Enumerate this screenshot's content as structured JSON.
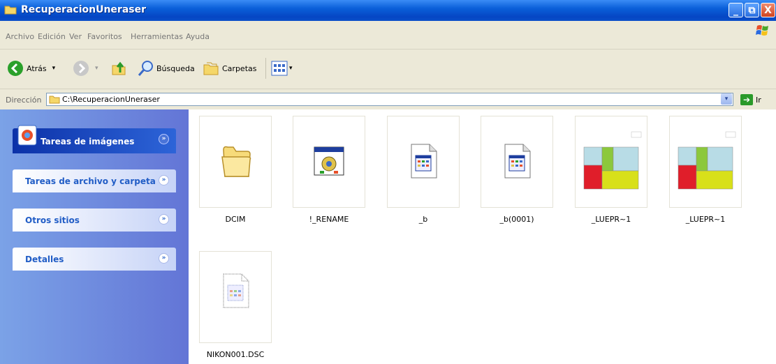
{
  "window": {
    "title": "RecuperacionUneraser"
  },
  "window_buttons": {
    "minimize": "_",
    "maximize": "⧉",
    "close": "X"
  },
  "menu": [
    "Archivo",
    "Edición",
    "Ver",
    "Favoritos",
    "Herramientas",
    "Ayuda"
  ],
  "toolbar": {
    "back": "Atrás",
    "search": "Búsqueda",
    "folders": "Carpetas",
    "dropdown_glyph": "▾"
  },
  "address": {
    "label": "Dirección",
    "path": "C:\\RecuperacionUneraser",
    "go": "Ir",
    "go_glyph": "➔",
    "drop_glyph": "▾"
  },
  "tasks": [
    {
      "label": "Tareas de imágenes"
    },
    {
      "label": "Tareas de archivo y carpeta"
    },
    {
      "label": "Otros sitios"
    },
    {
      "label": "Detalles"
    }
  ],
  "chevron_glyph": "»",
  "files": [
    {
      "name": "DCIM",
      "icon": "folder-icon"
    },
    {
      "name": "!_RENAME",
      "icon": "application-icon"
    },
    {
      "name": "_b",
      "icon": "document-icon"
    },
    {
      "name": "_b(0001)",
      "icon": "document-icon"
    },
    {
      "name": "_LUEPR~1",
      "icon": "floorplan-thumbnail"
    },
    {
      "name": "_LUEPR~1",
      "icon": "floorplan-thumbnail"
    },
    {
      "name": "NIKON001.DSC",
      "icon": "dotted-document-icon"
    }
  ],
  "colors": {
    "title_blue": "#0a5fd9",
    "task_pane": "#6b8ee0",
    "task_title": "#215dc6",
    "special_task": "#0c32a8"
  }
}
